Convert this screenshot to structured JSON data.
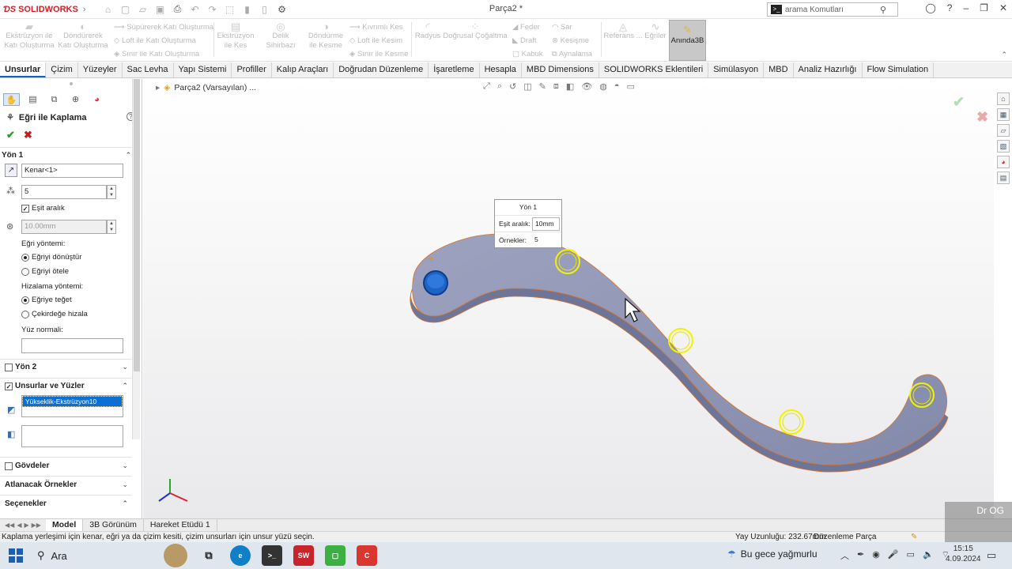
{
  "app": {
    "logo_brand": "SOLIDWORKS",
    "document_title": "Parça2 *",
    "search_placeholder": "arama Komutları"
  },
  "ribbon": {
    "buttons": [
      {
        "label": "Ekstrüzyon ile Katı Oluşturma"
      },
      {
        "label": "Döndürerek Katı Oluşturma"
      },
      {
        "label": "Süpürerek Katı Oluşturma"
      },
      {
        "label": "Loft ile Katı Oluşturma"
      },
      {
        "label": "Sınır ile Katı Oluşturma"
      },
      {
        "label": "Ekstrüzyon ile Kes"
      },
      {
        "label": "Delik Sihirbazı"
      },
      {
        "label": "Döndürme ile Kesme"
      },
      {
        "label": "Kıvrımlı Kes"
      },
      {
        "label": "Loft ile Kesim"
      },
      {
        "label": "Sınır ile Kesme"
      },
      {
        "label": "Radyus"
      },
      {
        "label": "Doğrusal Çoğaltma"
      },
      {
        "label": "Feder"
      },
      {
        "label": "Draft"
      },
      {
        "label": "Kabuk"
      },
      {
        "label": "Sar"
      },
      {
        "label": "Kesişme"
      },
      {
        "label": "Aynalama"
      },
      {
        "label": "Referans ..."
      },
      {
        "label": "Eğriler"
      },
      {
        "label": "Anında3B"
      }
    ]
  },
  "tabs": [
    {
      "label": "Unsurlar",
      "active": true
    },
    {
      "label": "Çizim"
    },
    {
      "label": "Yüzeyler"
    },
    {
      "label": "Sac Levha"
    },
    {
      "label": "Yapı Sistemi"
    },
    {
      "label": "Profiller"
    },
    {
      "label": "Kalıp Araçları"
    },
    {
      "label": "Doğrudan Düzenleme"
    },
    {
      "label": "İşaretleme"
    },
    {
      "label": "Hesapla"
    },
    {
      "label": "MBD Dimensions"
    },
    {
      "label": "SOLIDWORKS Eklentileri"
    },
    {
      "label": "Simülasyon"
    },
    {
      "label": "MBD"
    },
    {
      "label": "Analiz Hazırlığı"
    },
    {
      "label": "Flow Simulation"
    }
  ],
  "property_manager": {
    "title": "Eğri ile Kaplama",
    "direction1": {
      "header": "Yön 1",
      "edge_ref": "Kenar<1>",
      "instances": "5",
      "equal_spacing_label": "Eşit aralık",
      "equal_spacing_checked": true,
      "spacing": "10.00mm",
      "curve_method_label": "Eğri yöntemi:",
      "curve_method_options": [
        "Eğriyi dönüştür",
        "Eğriyi ötele"
      ],
      "curve_method_selected": 0,
      "align_method_label": "Hizalama yöntemi:",
      "align_method_options": [
        "Eğriye teğet",
        "Çekirdeğe hizala"
      ],
      "align_method_selected": 0,
      "face_normal_label": "Yüz normali:"
    },
    "direction2": {
      "header": "Yön 2"
    },
    "features_faces": {
      "header": "Unsurlar ve Yüzler",
      "selected_item": "Yükseklik-Ekstrüzyon10"
    },
    "bodies": {
      "header": "Gövdeler"
    },
    "skip_instances": {
      "header": "Atlanacak Örnekler"
    },
    "options": {
      "header": "Seçenekler"
    }
  },
  "viewport": {
    "breadcrumb": "Parça2 (Varsayılan) ...",
    "callout": {
      "title": "Yön 1",
      "spacing_label": "Eşit aralık:",
      "spacing_value": "10mm",
      "instances_label": "Örnekler:",
      "instances_value": "5"
    }
  },
  "bottom_tabs": [
    {
      "label": "Model",
      "active": true
    },
    {
      "label": "3B Görünüm"
    },
    {
      "label": "Hareket Etüdü 1"
    }
  ],
  "status": {
    "message": "Kaplama yerleşimi için kenar, eğri ya da çizim kesiti, çizim unsurları için unsur yüzü seçin.",
    "arc_length": "Yay Uzunluğu: 232.67mm",
    "mode": "Düzenleme Parça"
  },
  "taskbar": {
    "search_label": "Ara",
    "weather": "Bu gece yağmurlu",
    "time": "15:15",
    "date": "4.09.2024",
    "watermark": "Dr OG"
  },
  "colors": {
    "brand_red": "#d11f26",
    "part_surface": "#8f95b5",
    "seed_blue": "#1e63c8",
    "preview_yellow": "#f2f200",
    "selection_blue": "#0b6fd4"
  }
}
